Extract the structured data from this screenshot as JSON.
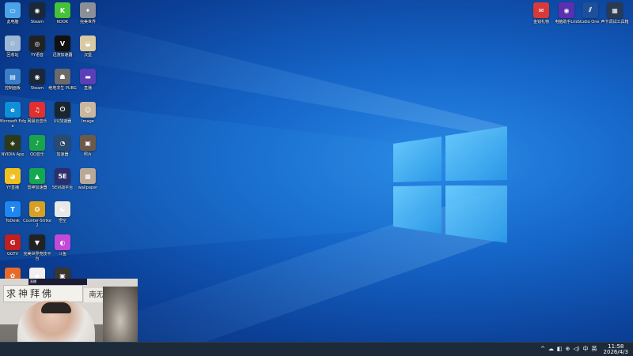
{
  "desktop_icons": [
    {
      "label": "此电脑",
      "name": "this-pc-icon",
      "color": "#4aa3e8",
      "glyph": "▭"
    },
    {
      "label": "Steam",
      "name": "steam-icon",
      "color": "#1b2838",
      "glyph": "◉"
    },
    {
      "label": "KOOK",
      "name": "kook-icon",
      "color": "#45c23a",
      "glyph": "K"
    },
    {
      "label": "完美世界",
      "name": "perfect-world-icon",
      "color": "#8a8f99",
      "glyph": "✦"
    },
    {
      "label": "回收站",
      "name": "recycle-bin-icon",
      "color": "#9cb8d6",
      "glyph": "♲"
    },
    {
      "label": "YY语音",
      "name": "yy-icon",
      "color": "#222222",
      "glyph": "◎"
    },
    {
      "label": "迅游加速器",
      "name": "xunyou-icon",
      "color": "#111111",
      "glyph": "V"
    },
    {
      "label": "汉堡",
      "name": "burger-icon",
      "color": "#d9c9a3",
      "glyph": "◒"
    },
    {
      "label": "控制面板",
      "name": "control-panel-icon",
      "color": "#3a7dc9",
      "glyph": "▤"
    },
    {
      "label": "Steam",
      "name": "steam-icon-2",
      "color": "#1b2838",
      "glyph": "◉"
    },
    {
      "label": "绝地求生 PUBG",
      "name": "pubg-icon",
      "color": "#6b6b6b",
      "glyph": "☗"
    },
    {
      "label": "直播",
      "name": "live-icon",
      "color": "#5a3fb8",
      "glyph": "▬"
    },
    {
      "label": "Microsoft Edge",
      "name": "edge-icon",
      "color": "#0f8fd8",
      "glyph": "e"
    },
    {
      "label": "网易云音乐",
      "name": "netease-music-icon",
      "color": "#e03030",
      "glyph": "♫"
    },
    {
      "label": "UU加速器",
      "name": "uu-icon",
      "color": "#1a2530",
      "glyph": "⏻"
    },
    {
      "label": "Image",
      "name": "image-icon",
      "color": "#c9b6a0",
      "glyph": "☺"
    },
    {
      "label": "NVIDIA App",
      "name": "nvidia-icon",
      "color": "#2d3a1a",
      "glyph": "◈"
    },
    {
      "label": "QQ音乐",
      "name": "qq-music-icon",
      "color": "#1aa34a",
      "glyph": "♪"
    },
    {
      "label": "加速器",
      "name": "speedometer-icon",
      "color": "#2b4a6e",
      "glyph": "◔"
    },
    {
      "label": "照片",
      "name": "photo-icon",
      "color": "#6e5a4a",
      "glyph": "▣"
    },
    {
      "label": "YY直播",
      "name": "yy-live-icon",
      "color": "#f0c020",
      "glyph": "◕"
    },
    {
      "label": "雷神加速器",
      "name": "leishen-icon",
      "color": "#14a850",
      "glyph": "▲"
    },
    {
      "label": "5E对战平台",
      "name": "5e-icon",
      "color": "#2b2f6e",
      "glyph": "5E"
    },
    {
      "label": "wallpaper",
      "name": "wallpaper-icon",
      "color": "#b8a898",
      "glyph": "▦"
    },
    {
      "label": "ToDesk",
      "name": "todesk-icon",
      "color": "#1e86f0",
      "glyph": "T"
    },
    {
      "label": "Counter-Strike 2",
      "name": "cs2-icon",
      "color": "#d8a020",
      "glyph": "✪"
    },
    {
      "label": "悟空",
      "name": "wukong-icon",
      "color": "#e8e8e8",
      "glyph": "☯"
    },
    {
      "label": "",
      "name": "blank-slot",
      "color": "",
      "glyph": ""
    },
    {
      "label": "GGTV",
      "name": "ggtv-icon",
      "color": "#c02020",
      "glyph": "G"
    },
    {
      "label": "完美世界竞技平台",
      "name": "perfect-arena-icon",
      "color": "#222222",
      "glyph": "▼"
    },
    {
      "label": "斗鱼",
      "name": "douyu-icon",
      "color": "#c34ad8",
      "glyph": "◐"
    },
    {
      "label": "",
      "name": "blank-slot-2",
      "color": "",
      "glyph": ""
    },
    {
      "label": "",
      "name": "fox-icon",
      "color": "#e86a2a",
      "glyph": "✿"
    },
    {
      "label": "",
      "name": "app-icon-2",
      "color": "#f0f0f0",
      "glyph": "◆"
    },
    {
      "label": "",
      "name": "photo-icon-2",
      "color": "#3a3530",
      "glyph": "▣"
    }
  ],
  "top_right_icons": [
    {
      "label": "金钱礼物",
      "name": "gift-icon",
      "color": "#d83a3a",
      "glyph": "✉"
    },
    {
      "label": "电脑助手Lite",
      "name": "assistant-icon",
      "color": "#5a2fb0",
      "glyph": "◉"
    },
    {
      "label": "Studio One 7",
      "name": "studio-one-icon",
      "color": "#1d4f9a",
      "glyph": "⫽"
    },
    {
      "label": "声卡调试工具箱",
      "name": "soundcard-icon",
      "color": "#2a3a50",
      "glyph": "▦"
    }
  ],
  "webcam": {
    "banner_text": "求神拜佛",
    "banner2_text": "南无阿",
    "overlay_text": "直播"
  },
  "taskbar": {
    "tray_icons": [
      "^",
      "☁",
      "◧",
      "⊕",
      "◁)",
      "中",
      "英"
    ],
    "time": "11:58",
    "date": "2026/4/3"
  }
}
